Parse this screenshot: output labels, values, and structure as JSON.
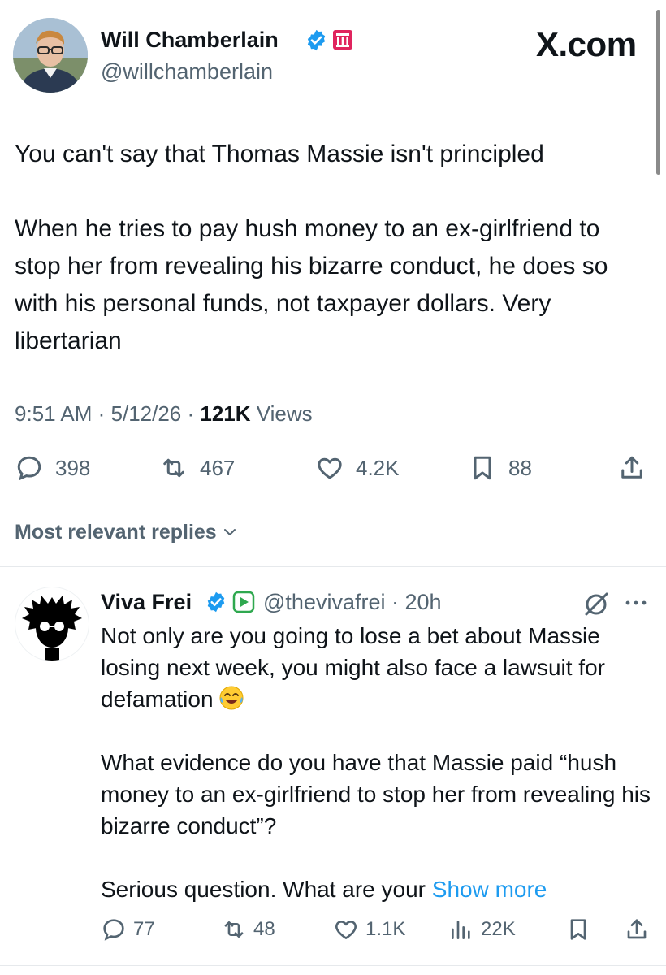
{
  "tweet": {
    "author_name": "Will Chamberlain",
    "author_handle": "@willchamberlain",
    "site_label": "X.com",
    "paragraphs": [
      "You can't say that Thomas Massie isn't principled",
      "When he tries to pay hush money to an ex-girlfriend to stop her from revealing his bizarre conduct, he does so with his personal funds, not taxpayer dollars. Very libertarian"
    ],
    "time": "9:51 AM",
    "date": "5/12/26",
    "views_count": "121K",
    "views_label": "Views",
    "stats": {
      "replies": "398",
      "reposts": "467",
      "likes": "4.2K",
      "bookmarks": "88"
    }
  },
  "replies_section": {
    "label": "Most relevant replies"
  },
  "reply": {
    "author_name": "Viva Frei",
    "author_handle": "@thevivafrei",
    "age": "20h",
    "paragraphs": [
      "Not only are you going to lose a bet about Massie losing next week, you might also face a lawsuit for defamation",
      "What evidence do you have that Massie paid “hush money to an ex-girlfriend to stop her from revealing his bizarre conduct”?",
      "Serious question. What are your"
    ],
    "show_more": "Show more",
    "stats": {
      "replies": "77",
      "reposts": "48",
      "likes": "1.1K",
      "views": "22K"
    }
  },
  "colors": {
    "text": "#0f1419",
    "secondary": "#536471",
    "link": "#1d9bf0",
    "verified": "#1d9bf0",
    "government_badge": "#e0245e",
    "play_badge": "#2fa84f"
  },
  "icons": [
    "verified-icon",
    "government-badge-icon",
    "reply-icon",
    "repost-icon",
    "like-icon",
    "bookmark-icon",
    "share-icon",
    "chevron-down-icon",
    "grok-icon",
    "more-icon",
    "views-icon",
    "laughing-emoji-icon",
    "play-badge-icon"
  ]
}
